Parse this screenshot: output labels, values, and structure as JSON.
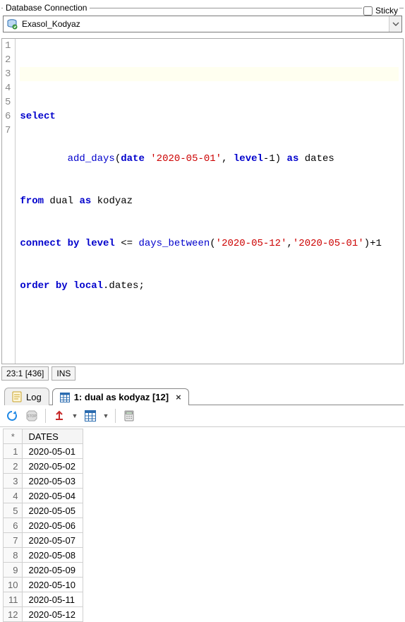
{
  "header": {
    "legend": "Database Connection",
    "sticky_label": "Sticky",
    "connection_name": "Exasol_Kodyaz"
  },
  "editor": {
    "lines": [
      "",
      "select",
      "        add_days(date '2020-05-01', level-1) as dates",
      "from dual as kodyaz",
      "connect by level <= days_between('2020-05-12','2020-05-01')+1",
      "order by local.dates;",
      ""
    ]
  },
  "status": {
    "pos": "23:1 [436]",
    "mode": "INS"
  },
  "tabs": {
    "log_label": "Log",
    "result_label": "1: dual as kodyaz [12]"
  },
  "results": {
    "corner": "*",
    "column_header": "DATES",
    "rows": [
      {
        "n": "1",
        "v": "2020-05-01"
      },
      {
        "n": "2",
        "v": "2020-05-02"
      },
      {
        "n": "3",
        "v": "2020-05-03"
      },
      {
        "n": "4",
        "v": "2020-05-04"
      },
      {
        "n": "5",
        "v": "2020-05-05"
      },
      {
        "n": "6",
        "v": "2020-05-06"
      },
      {
        "n": "7",
        "v": "2020-05-07"
      },
      {
        "n": "8",
        "v": "2020-05-08"
      },
      {
        "n": "9",
        "v": "2020-05-09"
      },
      {
        "n": "10",
        "v": "2020-05-10"
      },
      {
        "n": "11",
        "v": "2020-05-11"
      },
      {
        "n": "12",
        "v": "2020-05-12"
      }
    ]
  }
}
